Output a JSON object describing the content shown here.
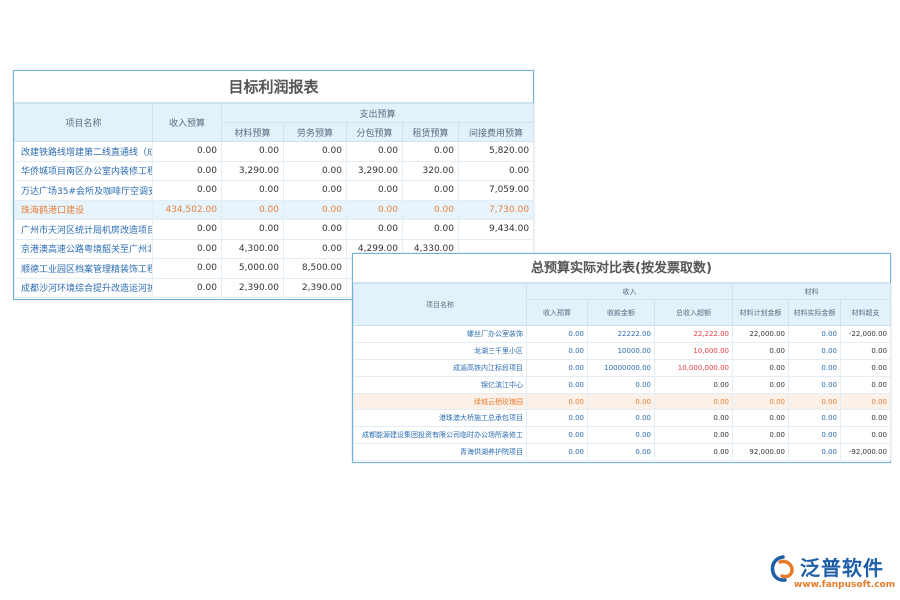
{
  "panel1": {
    "title": "目标利润报表",
    "headers": {
      "name": "项目名称",
      "income": "收入预算",
      "expense_group": "支出预算",
      "material": "材料预算",
      "labor": "劳务预算",
      "subcontract": "分包预算",
      "rental": "租赁预算",
      "indirect": "间接费用预算"
    },
    "rows": [
      {
        "name": "改建铁路线增建第二线直通线（成",
        "income": "0.00",
        "material": "0.00",
        "labor": "0.00",
        "subcontract": "0.00",
        "rental": "0.00",
        "indirect": "5,820.00"
      },
      {
        "name": "华侨城项目南区办公室内装修工程",
        "income": "0.00",
        "material": "3,290.00",
        "labor": "0.00",
        "subcontract": "3,290.00",
        "rental": "320.00",
        "indirect": "0.00"
      },
      {
        "name": "万达广场35#会所及咖啡厅空调安",
        "income": "0.00",
        "material": "0.00",
        "labor": "0.00",
        "subcontract": "0.00",
        "rental": "0.00",
        "indirect": "7,059.00"
      },
      {
        "name": "珠海鹤港口建设",
        "income": "434,502.00",
        "material": "0.00",
        "labor": "0.00",
        "subcontract": "0.00",
        "rental": "0.00",
        "indirect": "7,730.00",
        "highlight": true
      },
      {
        "name": "广州市天河区统计局机房改造项目",
        "income": "0.00",
        "material": "0.00",
        "labor": "0.00",
        "subcontract": "0.00",
        "rental": "0.00",
        "indirect": "9,434.00"
      },
      {
        "name": "京港澳高速公路粤境韶关至广州北",
        "income": "0.00",
        "material": "4,300.00",
        "labor": "0.00",
        "subcontract": "4,299.00",
        "rental": "4,330.00",
        "indirect": ""
      },
      {
        "name": "顺德工业园区档案管理精装饰工程",
        "income": "0.00",
        "material": "5,000.00",
        "labor": "8,500.00",
        "subcontract": "",
        "rental": "",
        "indirect": ""
      },
      {
        "name": "成都沙河环境综合提升改造运河护",
        "income": "0.00",
        "material": "2,390.00",
        "labor": "2,390.00",
        "subcontract": "",
        "rental": "",
        "indirect": ""
      }
    ]
  },
  "panel2": {
    "title": "总预算实际对比表(按发票取数)",
    "headers": {
      "name": "项目名称",
      "income_group": "收入",
      "income_budget": "收入预算",
      "received": "收款金额",
      "over_income": "总收入超额",
      "material_group": "材料",
      "material_plan": "材料计划金额",
      "material_actual": "材料实际金额",
      "material_over": "材料超支"
    },
    "rows": [
      {
        "name": "螺丝厂办公室装饰",
        "income_budget": "0.00",
        "received": "22222.00",
        "over_income": "22,222.00",
        "material_plan": "22,000.00",
        "material_actual": "0.00",
        "material_over": "-22,000.00"
      },
      {
        "name": "龙湖三千里小区",
        "income_budget": "0.00",
        "received": "10000.00",
        "over_income": "10,000.00",
        "material_plan": "0.00",
        "material_actual": "0.00",
        "material_over": "0.00"
      },
      {
        "name": "成渝高铁内江标段项目",
        "income_budget": "0.00",
        "received": "10000000.00",
        "over_income": "10,000,000.00",
        "material_plan": "0.00",
        "material_actual": "0.00",
        "material_over": "0.00"
      },
      {
        "name": "锦亿滨江中心",
        "income_budget": "0.00",
        "received": "0.00",
        "over_income": "0.00",
        "material_plan": "0.00",
        "material_actual": "0.00",
        "material_over": "0.00"
      },
      {
        "name": "绿城云栖玫瑰园",
        "income_budget": "0.00",
        "received": "0.00",
        "over_income": "0.00",
        "material_plan": "0.00",
        "material_actual": "0.00",
        "material_over": "0.00",
        "highlight": true
      },
      {
        "name": "港珠澳大桥施工总承包项目",
        "income_budget": "0.00",
        "received": "0.00",
        "over_income": "0.00",
        "material_plan": "0.00",
        "material_actual": "0.00",
        "material_over": "0.00"
      },
      {
        "name": "成都能源建设集团投资有限公司临时办公场所装修工",
        "income_budget": "0.00",
        "received": "0.00",
        "over_income": "0.00",
        "material_plan": "0.00",
        "material_actual": "0.00",
        "material_over": "0.00"
      },
      {
        "name": "青海供湖养护院项目",
        "income_budget": "0.00",
        "received": "0.00",
        "over_income": "0.00",
        "material_plan": "92,000.00",
        "material_actual": "0.00",
        "material_over": "-92,000.00"
      }
    ]
  },
  "logo": {
    "name": "泛普软件",
    "url": "www.fanpusoft.com"
  },
  "colors": {
    "header_bg": "#e3f1fb",
    "border": "#6db3dc",
    "link_blue": "#2b6cb0",
    "highlight_orange": "#e8813a",
    "red": "#e53e3e",
    "brand_blue": "#1f5fa8",
    "brand_orange": "#e57c2c"
  }
}
